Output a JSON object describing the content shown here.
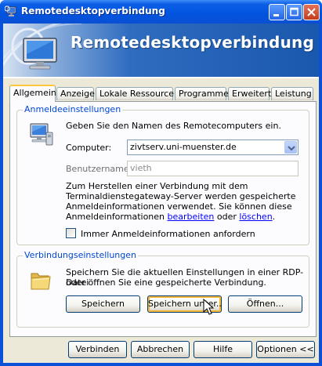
{
  "window": {
    "title": "Remotedesktopverbindung"
  },
  "banner": {
    "title": "Remotedesktopverbindung"
  },
  "tabs": [
    {
      "label": "Allgemein",
      "active": true
    },
    {
      "label": "Anzeige",
      "active": false
    },
    {
      "label": "Lokale Ressourcen",
      "active": false
    },
    {
      "label": "Programme",
      "active": false
    },
    {
      "label": "Erweitert",
      "active": false
    },
    {
      "label": "Leistung",
      "active": false
    }
  ],
  "login": {
    "group_label": "Anmeldeeinstellungen",
    "instruction": "Geben Sie den Namen des Remotecomputers ein.",
    "computer_label": "Computer:",
    "computer_value": "zivtserv.uni-muenster.de",
    "username_label": "Benutzername:",
    "username_value": "vieth",
    "info_line1": "Zum Herstellen einer Verbindung mit dem",
    "info_line2": "Terminaldienstegateway-Server werden gespeicherte",
    "info_line3": "Anmeldeinformationen verwendet. Sie können diese",
    "info_line4_prefix": "Anmeldeinformationen ",
    "edit_link": "bearbeiten",
    "info_line4_middle": " oder ",
    "delete_link": "löschen",
    "info_line4_suffix": ".",
    "always_ask_label": "Immer Anmeldeinformationen anfordern",
    "always_ask_checked": false
  },
  "connection": {
    "group_label": "Verbindungseinstellungen",
    "text_line1": "Speichern Sie die aktuellen Einstellungen in einer RDP-Datei",
    "text_line2": "oder öffnen Sie eine gespeicherte Verbindung.",
    "save_label": "Speichern",
    "save_as_label": "Speichern unter...",
    "open_label": "Öffnen..."
  },
  "footer": {
    "connect_label": "Verbinden",
    "cancel_label": "Abbrechen",
    "help_label": "Hilfe",
    "options_label": "Optionen <<"
  }
}
